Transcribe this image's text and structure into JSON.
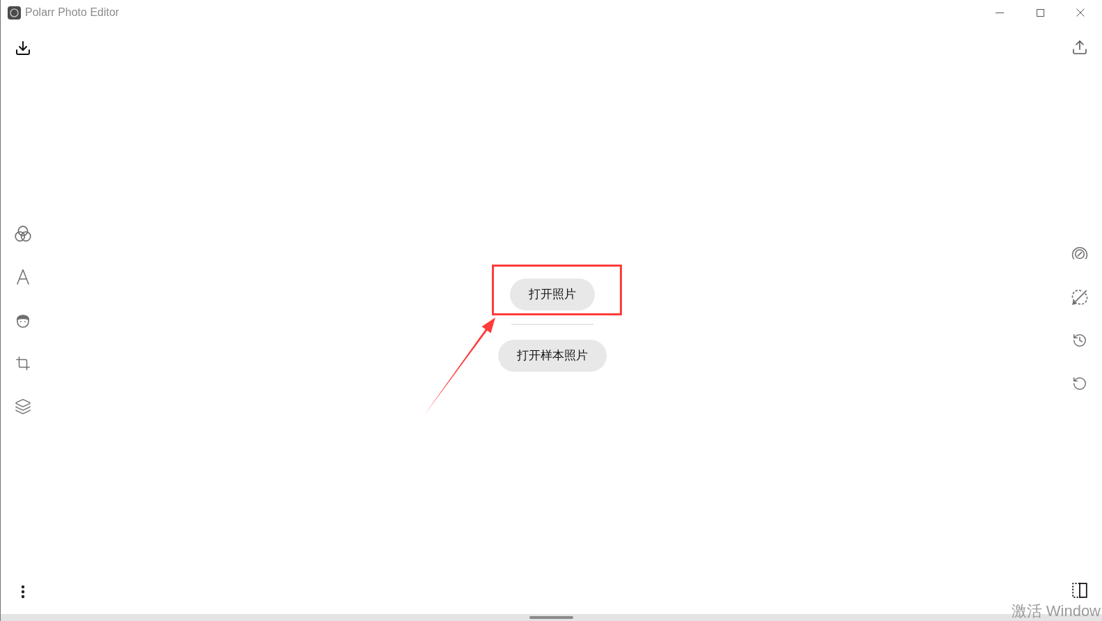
{
  "window": {
    "title": "Polarr Photo Editor"
  },
  "open_panel": {
    "buttons": [
      {
        "label": "打开照片",
        "highlighted": true
      },
      {
        "label": "打开样本照片",
        "highlighted": false
      }
    ]
  },
  "system_overlay": {
    "text": "激活 Window"
  }
}
